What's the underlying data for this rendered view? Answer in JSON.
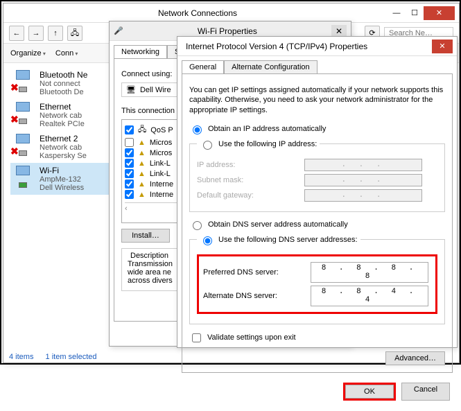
{
  "nc": {
    "title": "Network Connections",
    "search_placeholder": "Search Ne…",
    "organize": "Organize",
    "connect": "Conn",
    "items": [
      {
        "name": "Bluetooth Ne",
        "l2": "Not connect",
        "l3": "Bluetooth De",
        "x": true
      },
      {
        "name": "Ethernet",
        "l2": "Network cab",
        "l3": "Realtek PCIe",
        "x": true
      },
      {
        "name": "Ethernet 2",
        "l2": "Network cab",
        "l3": "Kaspersky Se",
        "x": true
      },
      {
        "name": "Wi-Fi",
        "l2": "AmpMe-132",
        "l3": "Dell Wireless",
        "x": false
      }
    ],
    "status_items": "4 items",
    "status_sel": "1 item selected"
  },
  "wifi": {
    "title": "Wi-Fi Properties",
    "tabs": [
      "Networking",
      "Sh"
    ],
    "connect_using": "Connect using:",
    "adapter": "Dell Wire",
    "conn_uses": "This connection",
    "items": [
      {
        "chk": true,
        "label": "QoS P"
      },
      {
        "chk": false,
        "label": "Micros"
      },
      {
        "chk": true,
        "label": "Micros"
      },
      {
        "chk": true,
        "label": "Link-L"
      },
      {
        "chk": true,
        "label": "Link-L"
      },
      {
        "chk": true,
        "label": "Interne"
      },
      {
        "chk": true,
        "label": "Interne"
      }
    ],
    "install": "Install…",
    "desc_title": "Description",
    "desc": "Transmission\nwide area ne\nacross divers"
  },
  "ipv4": {
    "title": "Internet Protocol Version 4 (TCP/IPv4) Properties",
    "tabs": [
      "General",
      "Alternate Configuration"
    ],
    "info": "You can get IP settings assigned automatically if your network supports this capability. Otherwise, you need to ask your network administrator for the appropriate IP settings.",
    "r_ip_auto": "Obtain an IP address automatically",
    "r_ip_man": "Use the following IP address:",
    "ip_label": "IP address:",
    "mask_label": "Subnet mask:",
    "gw_label": "Default gateway:",
    "ip_val": ".   .   .",
    "r_dns_auto": "Obtain DNS server address automatically",
    "r_dns_man": "Use the following DNS server addresses:",
    "pref_label": "Preferred DNS server:",
    "alt_label": "Alternate DNS server:",
    "pref_val": "8 . 8 . 8 . 8",
    "alt_val": "8 . 8 . 4 . 4",
    "validate": "Validate settings upon exit",
    "advanced": "Advanced…",
    "ok": "OK",
    "cancel": "Cancel"
  }
}
